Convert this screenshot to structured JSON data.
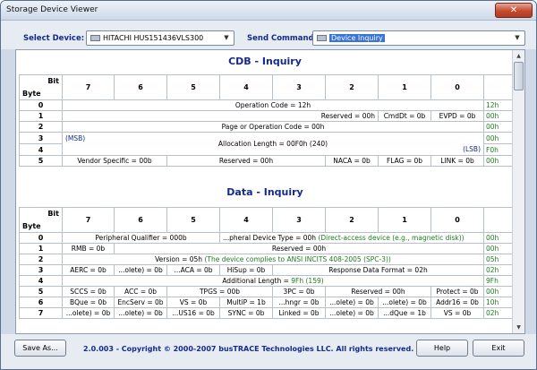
{
  "window": {
    "title": "Storage Device Viewer",
    "close": "✕"
  },
  "toolbar": {
    "device_label": "Select Device:",
    "device_value": "HITACHI HUS151436VLS300",
    "command_label": "Send Command:",
    "command_value": "Device Inquiry"
  },
  "cdb": {
    "title": "CDB - Inquiry",
    "bit_label": "Bit",
    "byte_label": "Byte",
    "bits": [
      "7",
      "6",
      "5",
      "4",
      "3",
      "2",
      "1",
      "0"
    ],
    "rows": [
      {
        "byte": "0",
        "text": "Operation Code = 12h",
        "hex": "12h"
      },
      {
        "byte": "1",
        "reserved": "Reserved = 00h",
        "cmddt": "CmdDt = 0b",
        "evpd": "EVPD = 0b",
        "hex": "00h"
      },
      {
        "byte": "2",
        "text": "Page or Operation Code = 00h",
        "hex": "00h"
      },
      {
        "byte": "3",
        "msb": "(MSB)",
        "text": "Allocation Length = 00F0h (240)",
        "hex": "00h"
      },
      {
        "byte": "4",
        "lsb": "(LSB)",
        "hex": "F0h"
      },
      {
        "byte": "5",
        "vendor": "Vendor Specific = 00b",
        "reserved": "Reserved = 00h",
        "naca": "NACA = 0b",
        "flag": "FLAG = 0b",
        "link": "LINK = 0b",
        "hex": "00h"
      }
    ]
  },
  "data": {
    "title": "Data - Inquiry",
    "rows": [
      {
        "byte": "0",
        "a": "Peripheral Qualifier = 000b",
        "b_pre": "...pheral Device Type = 00h",
        "b_post": "(Direct-access device (e.g., magnetic disk))",
        "hex": "00h"
      },
      {
        "byte": "1",
        "a": "RMB = 0b",
        "b": "Reserved = 00h",
        "hex": "00h"
      },
      {
        "byte": "2",
        "a_pre": "Version = 05h",
        "a_post": "(The device complies to ANSI INCITS 408-2005 (SPC-3))",
        "hex": "05h"
      },
      {
        "byte": "3",
        "a": "AERC = 0b",
        "b": "...olete) = 0b",
        "c": "...ACA = 0b",
        "d": "HiSup = 0b",
        "e": "Response Data Format = 02h",
        "hex": "02h"
      },
      {
        "byte": "4",
        "a_pre": "Additional Length =",
        "a_post": "9Fh (159)",
        "hex": "9Fh"
      },
      {
        "byte": "5",
        "a": "SCCS = 0b",
        "b": "ACC = 0b",
        "c": "TPGS = 00b",
        "d": "3PC = 0b",
        "e": "Reserved = 00h",
        "f": "Protect = 0b",
        "hex": "00h"
      },
      {
        "byte": "6",
        "cells": [
          "BQue = 0b",
          "EncServ = 0b",
          "VS = 0b",
          "MultiP = 1b",
          "...hngr = 0b",
          "...olete) = 0b",
          "...olete) = 0b",
          "Addr16 = 0b"
        ],
        "hex": "10h"
      },
      {
        "byte": "7",
        "cells": [
          "...olete) = 0b",
          "...olete) = 0b",
          "...US16 = 0b",
          "SYNC = 0b",
          "Linked = 0b",
          "...olete) = 0b",
          "...dQue = 1b",
          "VS = 0b"
        ],
        "hex": "02h"
      }
    ]
  },
  "footer": {
    "save": "Save As...",
    "copyright": "2.0.003 - Copyright © 2000-2007 busTRACE Technologies LLC.  All rights reserved.",
    "help": "Help",
    "exit": "Exit"
  },
  "colors": {
    "accent": "#152a8a",
    "value": "#207a20"
  }
}
